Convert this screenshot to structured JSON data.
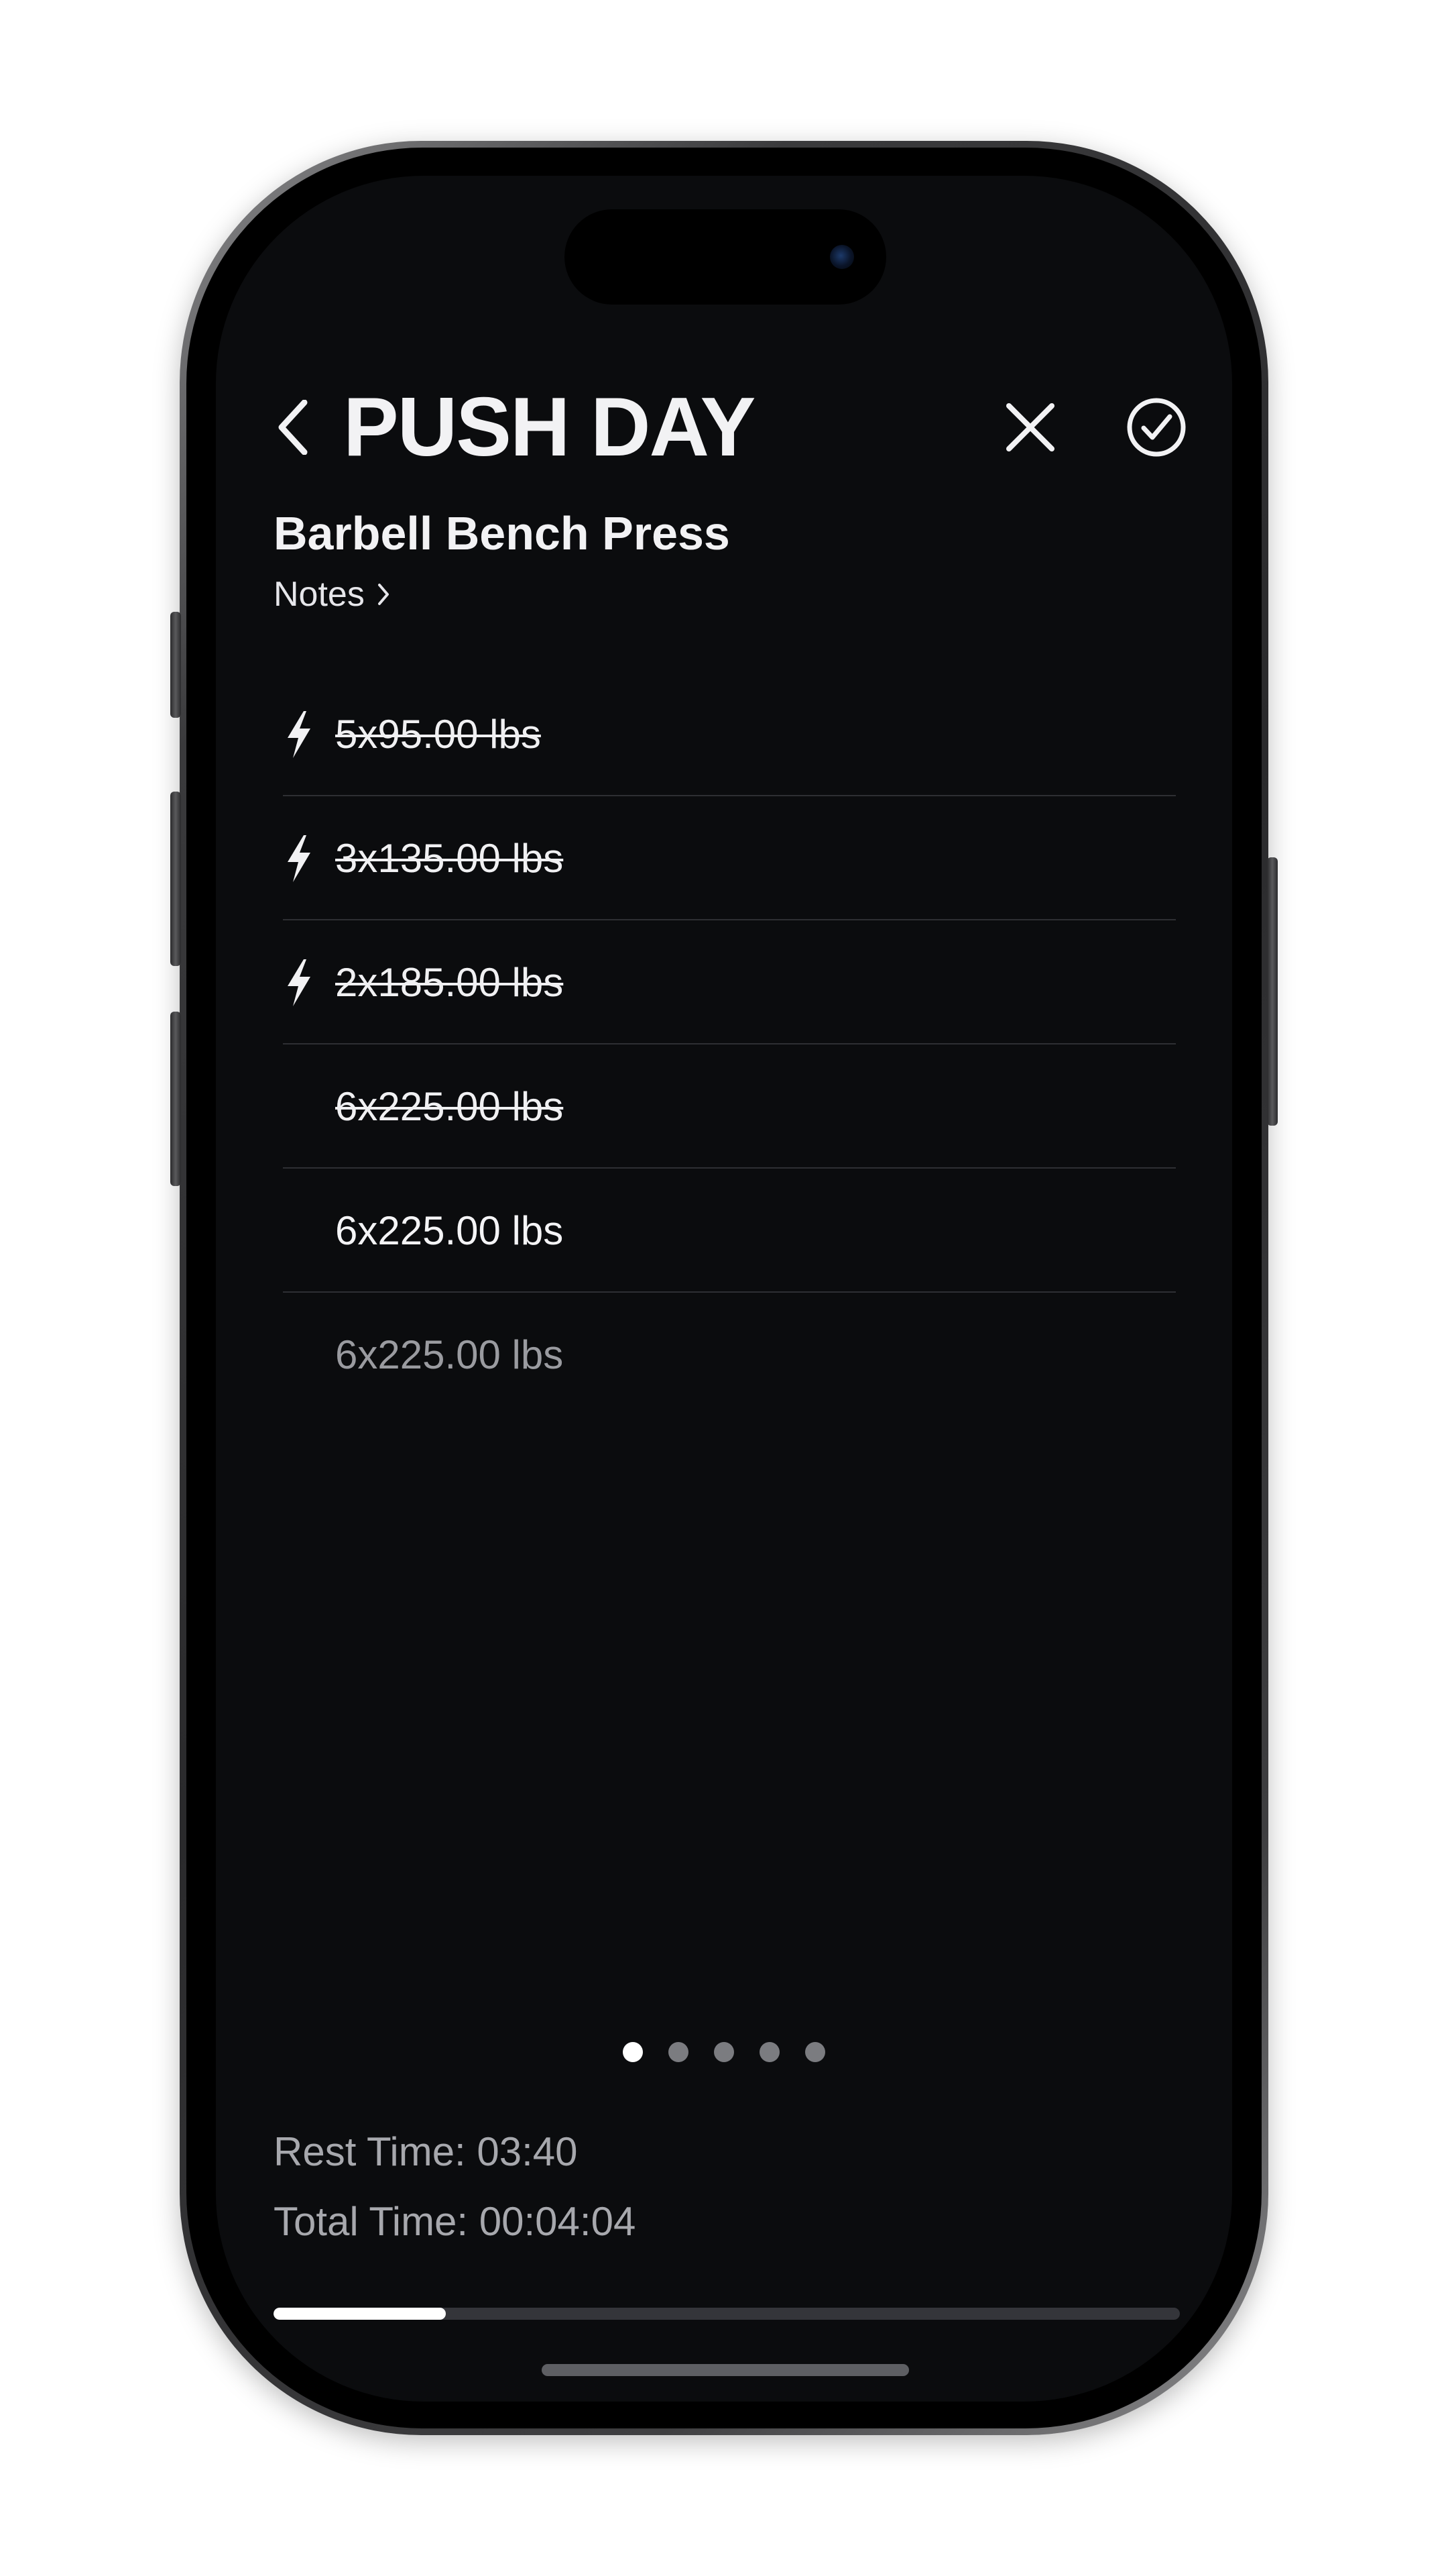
{
  "header": {
    "title": "PUSH DAY",
    "back_icon": "chevron-left-icon",
    "close_icon": "close-icon",
    "done_icon": "checkmark-circle-icon"
  },
  "exercise": {
    "name": "Barbell Bench Press",
    "notes_label": "Notes"
  },
  "sets": [
    {
      "text": "5x95.00 lbs",
      "status": "completed",
      "warmup": true
    },
    {
      "text": "3x135.00 lbs",
      "status": "completed",
      "warmup": true
    },
    {
      "text": "2x185.00 lbs",
      "status": "completed",
      "warmup": true
    },
    {
      "text": "6x225.00 lbs",
      "status": "completed",
      "warmup": false
    },
    {
      "text": "6x225.00 lbs",
      "status": "current",
      "warmup": false
    },
    {
      "text": "6x225.00 lbs",
      "status": "upcoming",
      "warmup": false
    }
  ],
  "pager": {
    "count": 5,
    "active_index": 0
  },
  "timers": {
    "rest_time": "Rest Time: 03:40",
    "total_time": "Total Time: 00:04:04"
  },
  "progress": {
    "fraction": 0.19
  },
  "colors": {
    "background": "#0b0c0e",
    "text_primary": "#f2f2f4",
    "text_secondary": "#a7a8ad",
    "divider": "#2e2f33"
  }
}
